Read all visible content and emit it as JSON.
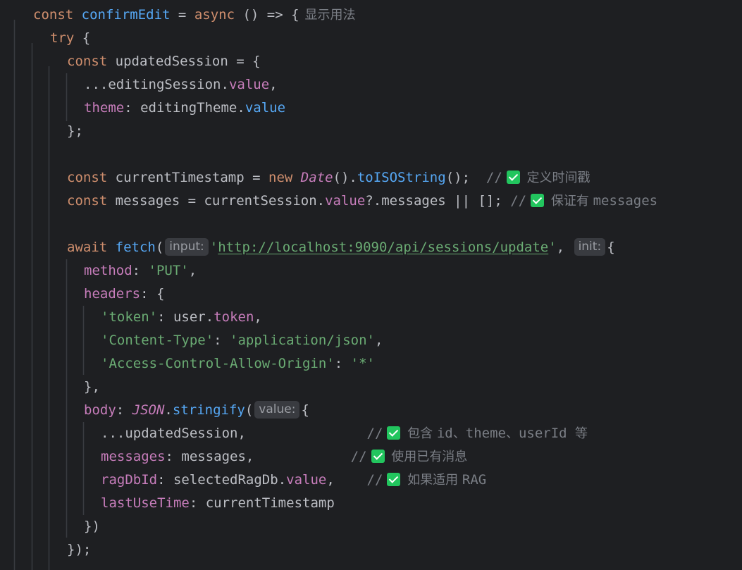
{
  "editor": {
    "background": "#1e1f22",
    "guide_color": "#393b40",
    "colors": {
      "keyword": "#cf8e6d",
      "function": "#56a8f5",
      "property": "#c77dbb",
      "string": "#6aab73",
      "identifier": "#bcbec4",
      "comment": "#7a7e85",
      "hint_background": "#393b40",
      "check_icon": "#22c55e"
    },
    "lines": [
      {
        "indent": 0,
        "tokens": [
          {
            "k": "kw",
            "t": "const "
          },
          {
            "k": "fn",
            "t": "confirmEdit"
          },
          {
            "k": "punc",
            "t": " = "
          },
          {
            "k": "kw",
            "t": "async"
          },
          {
            "k": "punc",
            "t": " () => {"
          },
          {
            "k": "inlay",
            "t": "显示用法"
          }
        ]
      },
      {
        "indent": 1,
        "tokens": [
          {
            "k": "kw",
            "t": "try"
          },
          {
            "k": "punc",
            "t": " {"
          }
        ]
      },
      {
        "indent": 2,
        "tokens": [
          {
            "k": "kw",
            "t": "const "
          },
          {
            "k": "id",
            "t": "updatedSession"
          },
          {
            "k": "punc",
            "t": " = {"
          }
        ]
      },
      {
        "indent": 3,
        "tokens": [
          {
            "k": "punc",
            "t": "..."
          },
          {
            "k": "id",
            "t": "editingSession"
          },
          {
            "k": "punc",
            "t": "."
          },
          {
            "k": "prop",
            "t": "value"
          },
          {
            "k": "punc",
            "t": ","
          }
        ]
      },
      {
        "indent": 3,
        "tokens": [
          {
            "k": "prop",
            "t": "theme"
          },
          {
            "k": "punc",
            "t": ": "
          },
          {
            "k": "id",
            "t": "editingTheme"
          },
          {
            "k": "punc",
            "t": "."
          },
          {
            "k": "fn",
            "t": "value"
          }
        ]
      },
      {
        "indent": 2,
        "tokens": [
          {
            "k": "punc",
            "t": "};"
          }
        ]
      },
      {
        "indent": 2,
        "tokens": []
      },
      {
        "indent": 2,
        "tokens": [
          {
            "k": "kw",
            "t": "const "
          },
          {
            "k": "id",
            "t": "currentTimestamp"
          },
          {
            "k": "punc",
            "t": " = "
          },
          {
            "k": "kw",
            "t": "new "
          },
          {
            "k": "cls",
            "t": "Date"
          },
          {
            "k": "punc",
            "t": "()."
          },
          {
            "k": "fn",
            "t": "toISOString"
          },
          {
            "k": "punc",
            "t": "();  "
          },
          {
            "k": "cmt",
            "t": "//"
          },
          {
            "k": "check",
            "t": ""
          },
          {
            "k": "cjk",
            "t": " 定义时间戳"
          }
        ]
      },
      {
        "indent": 2,
        "tokens": [
          {
            "k": "kw",
            "t": "const "
          },
          {
            "k": "id",
            "t": "messages"
          },
          {
            "k": "punc",
            "t": " = "
          },
          {
            "k": "id",
            "t": "currentSession"
          },
          {
            "k": "punc",
            "t": "."
          },
          {
            "k": "prop",
            "t": "value"
          },
          {
            "k": "punc",
            "t": "?."
          },
          {
            "k": "id",
            "t": "messages"
          },
          {
            "k": "punc",
            "t": " || []; "
          },
          {
            "k": "cmt",
            "t": "//"
          },
          {
            "k": "check",
            "t": ""
          },
          {
            "k": "cjk",
            "t": " 保证有 "
          },
          {
            "k": "cmt",
            "t": "messages"
          }
        ]
      },
      {
        "indent": 2,
        "tokens": []
      },
      {
        "indent": 2,
        "tokens": [
          {
            "k": "kw",
            "t": "await "
          },
          {
            "k": "fn",
            "t": "fetch"
          },
          {
            "k": "punc",
            "t": "("
          },
          {
            "k": "hint",
            "t": "input:"
          },
          {
            "k": "str",
            "t": "'"
          },
          {
            "k": "url",
            "t": "http://localhost:9090/api/sessions/update"
          },
          {
            "k": "str",
            "t": "'"
          },
          {
            "k": "punc",
            "t": ", "
          },
          {
            "k": "hint",
            "t": "init:"
          },
          {
            "k": "punc",
            "t": "{"
          }
        ]
      },
      {
        "indent": 3,
        "tokens": [
          {
            "k": "prop",
            "t": "method"
          },
          {
            "k": "punc",
            "t": ": "
          },
          {
            "k": "str",
            "t": "'PUT'"
          },
          {
            "k": "punc",
            "t": ","
          }
        ]
      },
      {
        "indent": 3,
        "tokens": [
          {
            "k": "prop",
            "t": "headers"
          },
          {
            "k": "punc",
            "t": ": {"
          }
        ]
      },
      {
        "indent": 4,
        "tokens": [
          {
            "k": "str",
            "t": "'token'"
          },
          {
            "k": "punc",
            "t": ": "
          },
          {
            "k": "id",
            "t": "user"
          },
          {
            "k": "punc",
            "t": "."
          },
          {
            "k": "prop",
            "t": "token"
          },
          {
            "k": "punc",
            "t": ","
          }
        ]
      },
      {
        "indent": 4,
        "tokens": [
          {
            "k": "str",
            "t": "'Content-Type'"
          },
          {
            "k": "punc",
            "t": ": "
          },
          {
            "k": "str",
            "t": "'application/json'"
          },
          {
            "k": "punc",
            "t": ","
          }
        ]
      },
      {
        "indent": 4,
        "tokens": [
          {
            "k": "str",
            "t": "'Access-Control-Allow-Origin'"
          },
          {
            "k": "punc",
            "t": ": "
          },
          {
            "k": "str",
            "t": "'*'"
          }
        ]
      },
      {
        "indent": 3,
        "tokens": [
          {
            "k": "punc",
            "t": "},"
          }
        ]
      },
      {
        "indent": 3,
        "tokens": [
          {
            "k": "prop",
            "t": "body"
          },
          {
            "k": "punc",
            "t": ": "
          },
          {
            "k": "cls",
            "t": "JSON"
          },
          {
            "k": "punc",
            "t": "."
          },
          {
            "k": "fn",
            "t": "stringify"
          },
          {
            "k": "punc",
            "t": "("
          },
          {
            "k": "hint",
            "t": "value:"
          },
          {
            "k": "punc",
            "t": "{"
          }
        ]
      },
      {
        "indent": 4,
        "tokens": [
          {
            "k": "punc",
            "t": "..."
          },
          {
            "k": "id",
            "t": "updatedSession"
          },
          {
            "k": "punc",
            "t": ",               "
          },
          {
            "k": "cmt",
            "t": "//"
          },
          {
            "k": "check",
            "t": ""
          },
          {
            "k": "cjk",
            "t": " 包含 "
          },
          {
            "k": "cmt",
            "t": "id"
          },
          {
            "k": "cjk",
            "t": "、"
          },
          {
            "k": "cmt",
            "t": "theme"
          },
          {
            "k": "cjk",
            "t": "、"
          },
          {
            "k": "cmt",
            "t": "userId "
          },
          {
            "k": "cjk",
            "t": "等"
          }
        ]
      },
      {
        "indent": 4,
        "tokens": [
          {
            "k": "prop",
            "t": "messages"
          },
          {
            "k": "punc",
            "t": ": "
          },
          {
            "k": "id",
            "t": "messages"
          },
          {
            "k": "punc",
            "t": ",            "
          },
          {
            "k": "cmt",
            "t": "//"
          },
          {
            "k": "check",
            "t": ""
          },
          {
            "k": "cjk",
            "t": " 使用已有消息"
          }
        ]
      },
      {
        "indent": 4,
        "tokens": [
          {
            "k": "prop",
            "t": "ragDbId"
          },
          {
            "k": "punc",
            "t": ": "
          },
          {
            "k": "id",
            "t": "selectedRagDb"
          },
          {
            "k": "punc",
            "t": "."
          },
          {
            "k": "prop",
            "t": "value"
          },
          {
            "k": "punc",
            "t": ",    "
          },
          {
            "k": "cmt",
            "t": "//"
          },
          {
            "k": "check",
            "t": ""
          },
          {
            "k": "cjk",
            "t": " 如果适用 "
          },
          {
            "k": "cmt",
            "t": "RAG"
          }
        ]
      },
      {
        "indent": 4,
        "tokens": [
          {
            "k": "prop",
            "t": "lastUseTime"
          },
          {
            "k": "punc",
            "t": ": "
          },
          {
            "k": "id",
            "t": "currentTimestamp"
          }
        ]
      },
      {
        "indent": 3,
        "tokens": [
          {
            "k": "punc",
            "t": "})"
          }
        ]
      },
      {
        "indent": 2,
        "tokens": [
          {
            "k": "punc",
            "t": "});"
          }
        ]
      }
    ]
  }
}
